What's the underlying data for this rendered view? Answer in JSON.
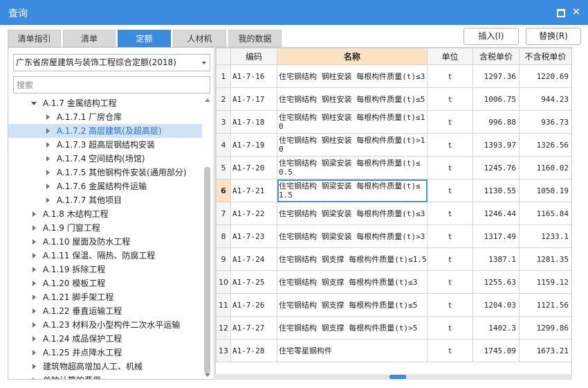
{
  "window": {
    "title": "查询"
  },
  "tabs": [
    {
      "label": "清单指引"
    },
    {
      "label": "清单"
    },
    {
      "label": "定额"
    },
    {
      "label": "人材机"
    },
    {
      "label": "我的数据"
    }
  ],
  "actions": {
    "insert": "插入(I)",
    "replace": "替换(R)"
  },
  "left": {
    "library": "广东省房屋建筑与装饰工程综合定额(2018)",
    "search_placeholder": "搜索",
    "tree": [
      {
        "label": "A.1.7 金属结构工程",
        "expanded": true,
        "level": 1
      },
      {
        "label": "A.1.7.1 厂房仓库",
        "level": 2
      },
      {
        "label": "A.1.7.2 高层建筑(及超高层)",
        "level": 2,
        "selected": true
      },
      {
        "label": "A.1.7.3 超高层钢结构安装",
        "level": 2
      },
      {
        "label": "A.1.7.4 空间结构(场馆)",
        "level": 2
      },
      {
        "label": "A.1.7.5 其他钢构件安装(通用部分)",
        "level": 2
      },
      {
        "label": "A.1.7.6 金属结构件运输",
        "level": 2
      },
      {
        "label": "A.1.7.7 其他项目",
        "level": 2
      },
      {
        "label": "A.1.8 木结构工程",
        "level": 1
      },
      {
        "label": "A.1.9 门窗工程",
        "level": 1
      },
      {
        "label": "A.1.10 屋面及防水工程",
        "level": 1
      },
      {
        "label": "A.1.11 保温、隔热、防腐工程",
        "level": 1
      },
      {
        "label": "A.1.19 拆除工程",
        "level": 1
      },
      {
        "label": "A.1.20 模板工程",
        "level": 1
      },
      {
        "label": "A.1.21 脚手架工程",
        "level": 1
      },
      {
        "label": "A.1.22 垂直运输工程",
        "level": 1
      },
      {
        "label": "A.1.23 材料及小型构件二次水平运输",
        "level": 1
      },
      {
        "label": "A.1.24 成品保护工程",
        "level": 1
      },
      {
        "label": "A.1.25 井点降水工程",
        "level": 1
      },
      {
        "label": "建筑物超高增加人工、机械",
        "level": 1
      },
      {
        "label": "单独计算的费用",
        "level": 1
      }
    ]
  },
  "grid": {
    "columns": [
      "",
      "编码",
      "名称",
      "单位",
      "含税单价",
      "不含税单价"
    ],
    "current_row": 6,
    "rows": [
      {
        "n": "1",
        "code": "A1-7-16",
        "name": "住宅钢结构 钢柱安装 每根构件质量(t)≤3",
        "unit": "t",
        "tax": "1297.36",
        "notax": "1220.69"
      },
      {
        "n": "2",
        "code": "A1-7-17",
        "name": "住宅钢结构 钢柱安装 每根构件质量(t)≤5",
        "unit": "t",
        "tax": "1006.75",
        "notax": "944.23"
      },
      {
        "n": "3",
        "code": "A1-7-18",
        "name": "住宅钢结构 钢柱安装 每根构件质量(t)≤10",
        "unit": "t",
        "tax": "996.88",
        "notax": "936.73"
      },
      {
        "n": "4",
        "code": "A1-7-19",
        "name": "住宅钢结构 钢柱安装 每根构件质量(t)>10",
        "unit": "t",
        "tax": "1393.97",
        "notax": "1326.56"
      },
      {
        "n": "5",
        "code": "A1-7-20",
        "name": "住宅钢结构 钢梁安装 每根构件质量(t)≤0.5",
        "unit": "t",
        "tax": "1245.76",
        "notax": "1160.02"
      },
      {
        "n": "6",
        "code": "A1-7-21",
        "name": "住宅钢结构 钢梁安装 每根构件质量(t)≤1.5",
        "unit": "t",
        "tax": "1130.55",
        "notax": "1050.19"
      },
      {
        "n": "7",
        "code": "A1-7-22",
        "name": "住宅钢结构 钢梁安装 每根构件质量(t)≤3",
        "unit": "t",
        "tax": "1246.44",
        "notax": "1165.84"
      },
      {
        "n": "8",
        "code": "A1-7-23",
        "name": "住宅钢结构 钢梁安装 每根构件质量(t)>3",
        "unit": "t",
        "tax": "1317.49",
        "notax": "1233.1"
      },
      {
        "n": "9",
        "code": "A1-7-24",
        "name": "住宅钢结构 钢支撑 每根构件质量(t)≤1.5",
        "unit": "t",
        "tax": "1387.1",
        "notax": "1281.35"
      },
      {
        "n": "10",
        "code": "A1-7-25",
        "name": "住宅钢结构 钢支撑 每根构件质量(t)≤3",
        "unit": "t",
        "tax": "1255.63",
        "notax": "1159.12"
      },
      {
        "n": "11",
        "code": "A1-7-26",
        "name": "住宅钢结构 钢支撑 每根构件质量(t)≤5",
        "unit": "t",
        "tax": "1204.03",
        "notax": "1121.56"
      },
      {
        "n": "12",
        "code": "A1-7-27",
        "name": "住宅钢结构 钢支撑 每根构件质量(t)>5",
        "unit": "t",
        "tax": "1402.3",
        "notax": "1299.86"
      },
      {
        "n": "13",
        "code": "A1-7-28",
        "name": "住宅零星钢构件",
        "unit": "t",
        "tax": "1745.09",
        "notax": "1673.21"
      }
    ]
  },
  "colors": {
    "accent": "#3b8ce0",
    "header_highlight": "#fbe2c2",
    "selection": "#cfe3f7"
  }
}
